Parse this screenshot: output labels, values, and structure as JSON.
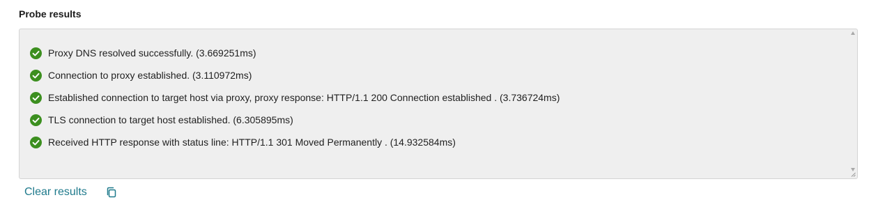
{
  "section": {
    "title": "Probe results"
  },
  "results": [
    {
      "status": "success",
      "icon": "check-circle-icon",
      "text": "Proxy DNS resolved successfully. (3.669251ms)"
    },
    {
      "status": "success",
      "icon": "check-circle-icon",
      "text": "Connection to proxy established. (3.110972ms)"
    },
    {
      "status": "success",
      "icon": "check-circle-icon",
      "text": "Established connection to target host via proxy, proxy response: HTTP/1.1 200 Connection established . (3.736724ms)"
    },
    {
      "status": "success",
      "icon": "check-circle-icon",
      "text": "TLS connection to target host established. (6.305895ms)"
    },
    {
      "status": "success",
      "icon": "check-circle-icon",
      "text": "Received HTTP response with status line: HTTP/1.1 301 Moved Permanently . (14.932584ms)"
    }
  ],
  "actions": {
    "clear_label": "Clear results",
    "copy_icon": "copy-icon"
  },
  "colors": {
    "success": "#3c8f1f",
    "link": "#1f7a8c",
    "box_background": "#efefef"
  }
}
